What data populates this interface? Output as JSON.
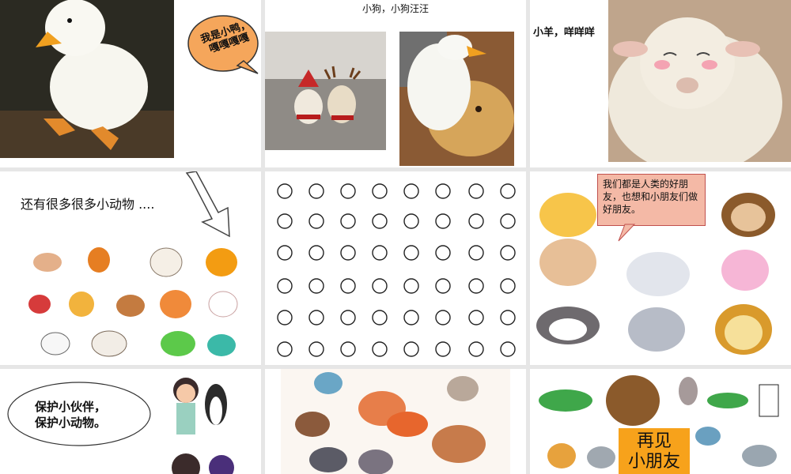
{
  "slides": {
    "duck": {
      "speech": "我是小鸭，嘎嘎嘎嘎"
    },
    "dog": {
      "caption": "小狗，小狗汪汪"
    },
    "sheep": {
      "caption": "小羊，咩咩咩"
    },
    "more_animals": {
      "text": "还有很多很多小动物 ...."
    },
    "friends": {
      "text": "我们都是人类的好朋友，也想和小朋友们做好朋友。"
    },
    "protect": {
      "line1": "保护小伙伴，",
      "line2": "保护小动物。"
    },
    "goodbye": {
      "line1": "再见",
      "line2": "小朋友"
    }
  },
  "colors": {
    "speech_bubble": "#f5a65b",
    "friends_box": "#f4b9a6",
    "friends_border": "#c0504d",
    "goodbye_box": "#f7a21b"
  }
}
